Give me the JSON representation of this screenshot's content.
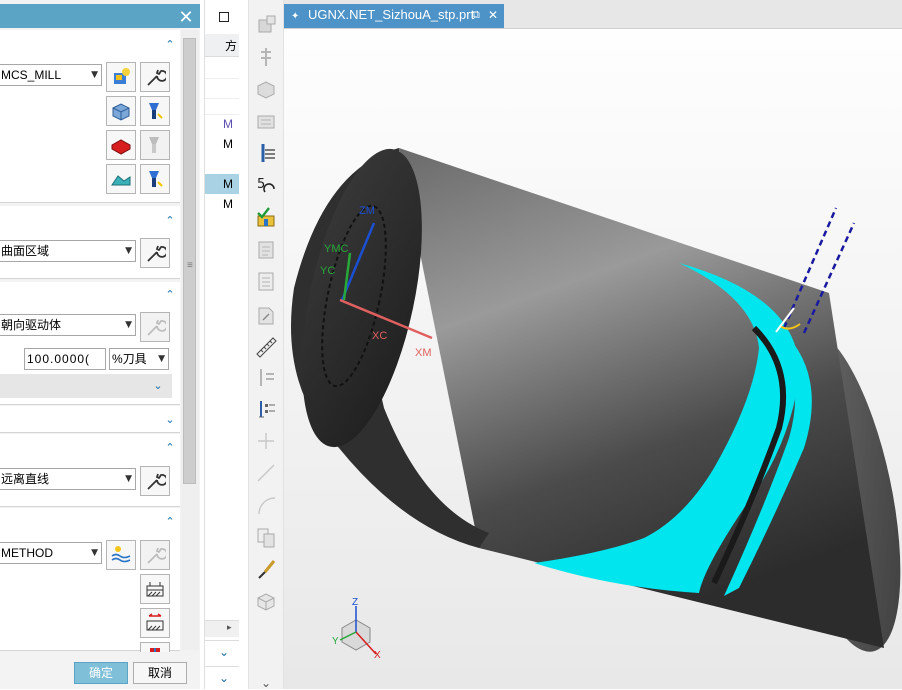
{
  "dialog": {
    "group1": {
      "method_select": "MCS_MILL"
    },
    "group2": {
      "select": "曲面区域"
    },
    "group3": {
      "select": "朝向驱动体",
      "number_value": "100.0000(",
      "unit_select": "%刀具"
    },
    "group5": {
      "select": "远离直线"
    },
    "group6": {
      "select": "METHOD"
    },
    "buttons": {
      "ok": "确定",
      "cancel": "取消"
    }
  },
  "nav": {
    "header": "方",
    "rows": [
      "M",
      "M",
      "M",
      "M"
    ],
    "selected_row": 2,
    "row_colors": [
      "#5b4fb0",
      "#000000",
      "#000000",
      "#000000"
    ]
  },
  "toolbar": {
    "icons": [
      "create-program-icon",
      "create-tool-icon",
      "create-geometry-icon",
      "create-operation-icon",
      "generate-toolpath-icon",
      "replay-toolpath-icon",
      "verify-toolpath-icon",
      "list-toolpath-icon",
      "postprocess-icon",
      "shop-docs-icon",
      "measure-icon",
      "feeds-icon",
      "tool-list-icon",
      "point-icon",
      "line-icon",
      "arc-icon",
      "copy-icon",
      "paint-brush-icon",
      "workpiece-icon"
    ],
    "bottom_label": "⌄"
  },
  "viewport": {
    "tab_title": "UGNX.NET_SizhouA_stp.prt",
    "labels": {
      "zm": "ZM",
      "ymc": "YMC",
      "yc": "YC",
      "xc": "XC",
      "xm": "XM"
    },
    "triad": {
      "z": "Z",
      "y": "Y",
      "x": "X"
    }
  },
  "colors": {
    "accent": "#5ba4c5",
    "tab": "#4d93c8",
    "toolpath": "#00e5ee",
    "part": "#4a4a4a"
  }
}
